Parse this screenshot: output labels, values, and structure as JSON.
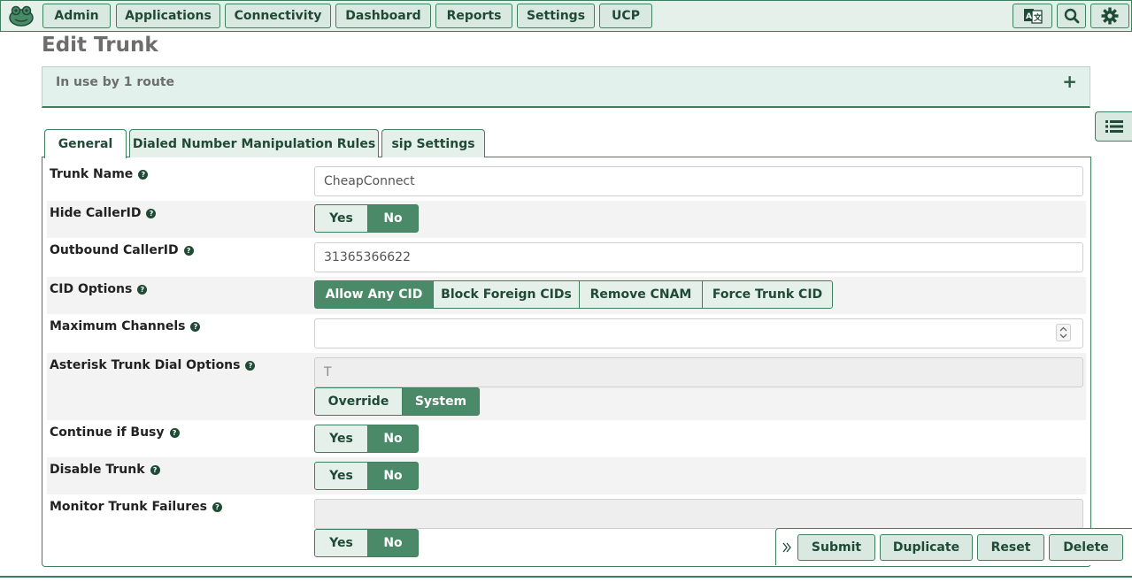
{
  "nav": {
    "items": [
      "Admin",
      "Applications",
      "Connectivity",
      "Dashboard",
      "Reports",
      "Settings",
      "UCP"
    ]
  },
  "page": {
    "title": "Edit Trunk"
  },
  "usage": {
    "text": "In use by 1 route",
    "expand": "+"
  },
  "tabs": [
    "General",
    "Dialed Number Manipulation Rules",
    "sip Settings"
  ],
  "form": {
    "trunk_name": {
      "label": "Trunk Name",
      "value": "CheapConnect"
    },
    "hide_callerid": {
      "label": "Hide CallerID",
      "yes": "Yes",
      "no": "No",
      "selected": "No"
    },
    "outbound_callerid": {
      "label": "Outbound CallerID",
      "value": "31365366622"
    },
    "cid_options": {
      "label": "CID Options",
      "options": [
        "Allow Any CID",
        "Block Foreign CIDs",
        "Remove CNAM",
        "Force Trunk CID"
      ],
      "selected": "Allow Any CID"
    },
    "max_channels": {
      "label": "Maximum Channels",
      "value": ""
    },
    "dial_options": {
      "label": "Asterisk Trunk Dial Options",
      "value": "T",
      "override": "Override",
      "system": "System",
      "selected": "System"
    },
    "continue_if_busy": {
      "label": "Continue if Busy",
      "yes": "Yes",
      "no": "No",
      "selected": "No"
    },
    "disable_trunk": {
      "label": "Disable Trunk",
      "yes": "Yes",
      "no": "No",
      "selected": "No"
    },
    "monitor_failures": {
      "label": "Monitor Trunk Failures",
      "value": "",
      "yes": "Yes",
      "no": "No",
      "selected": "No"
    }
  },
  "actions": {
    "submit": "Submit",
    "duplicate": "Duplicate",
    "reset": "Reset",
    "delete": "Delete"
  },
  "colors": {
    "accent": "#3f7f5c",
    "selected": "#4b8a68",
    "panel": "#e3f1ed"
  }
}
